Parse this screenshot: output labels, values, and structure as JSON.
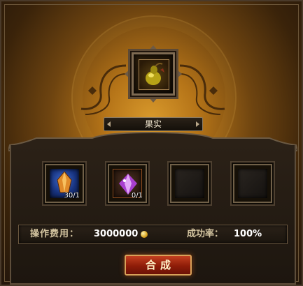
{
  "result_item": {
    "name": "果实",
    "icon": "fruit-icon"
  },
  "material_slots": [
    {
      "icon": "orange-crystal-icon",
      "count": "30/1",
      "color": "#2a5ac0"
    },
    {
      "icon": "purple-crystal-icon",
      "count": "0/1",
      "color": "#b050d8"
    },
    {
      "icon": "",
      "count": ""
    },
    {
      "icon": "",
      "count": ""
    }
  ],
  "cost": {
    "label": "操作费用：",
    "value": "3000000",
    "currency_icon": "gold-coin-icon"
  },
  "success": {
    "label": "成功率：",
    "value": "100%"
  },
  "synthesize_button": {
    "label": "合成"
  }
}
